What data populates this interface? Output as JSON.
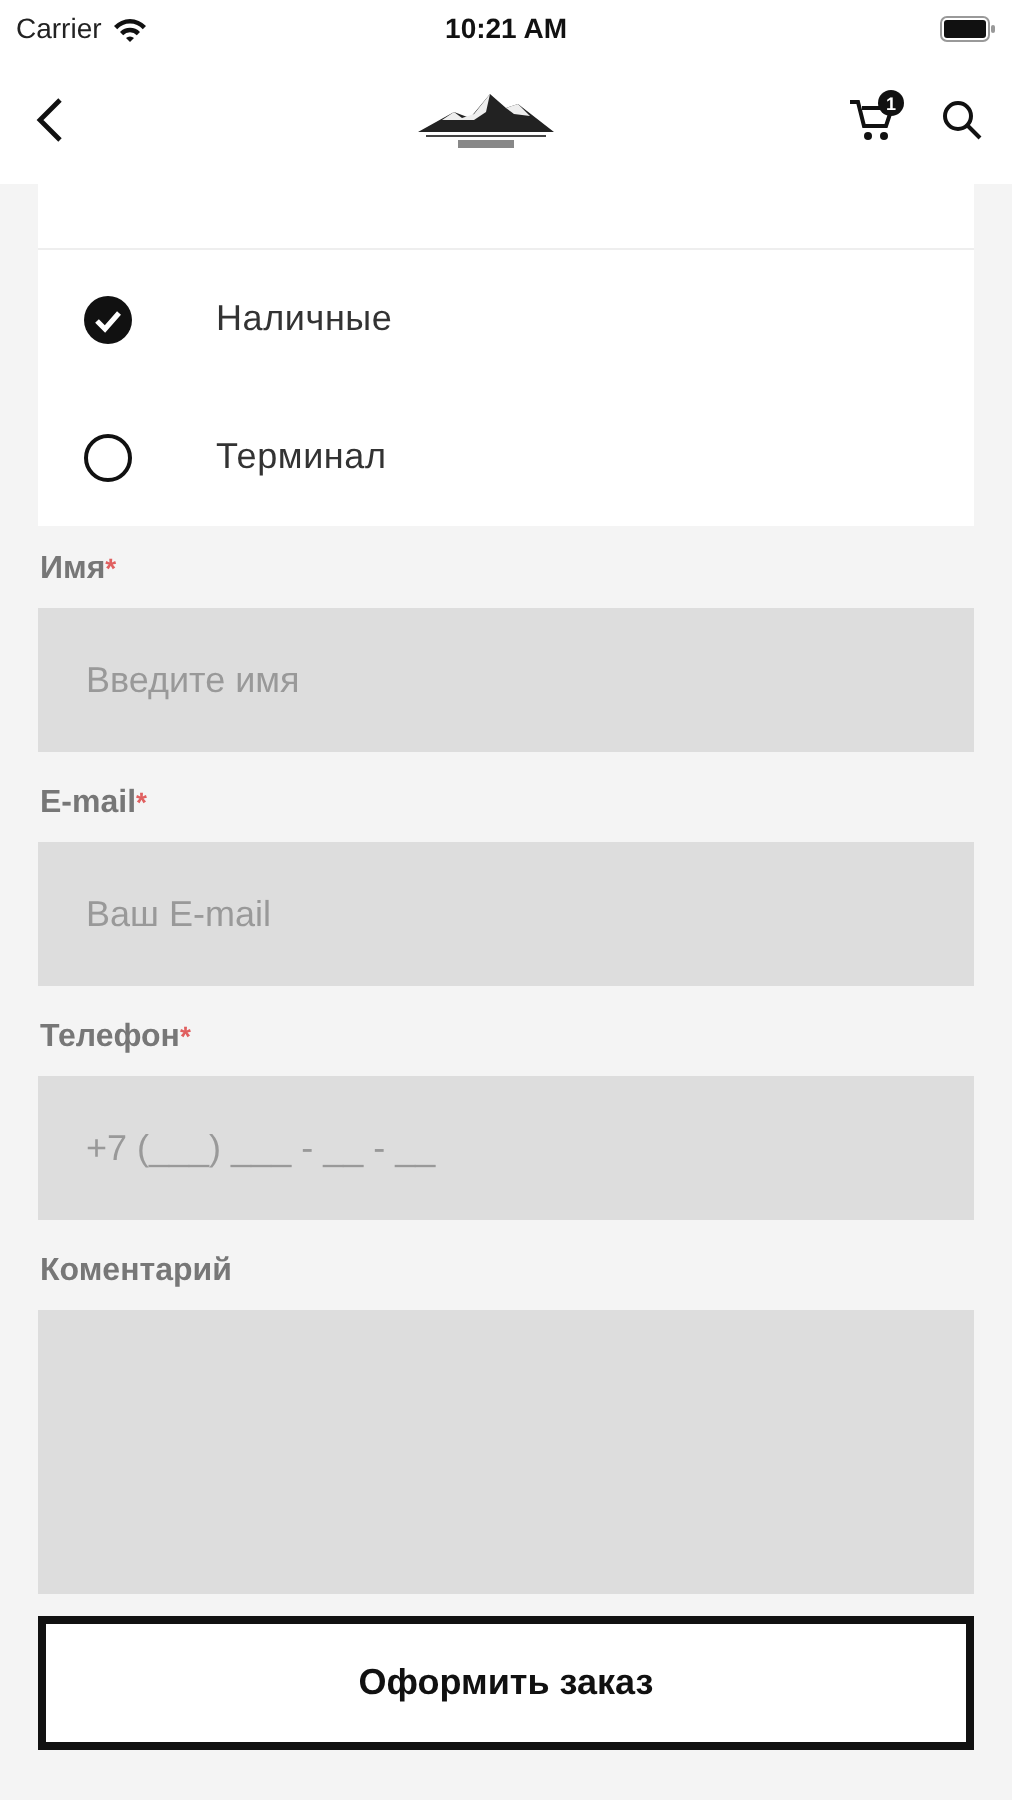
{
  "status_bar": {
    "carrier": "Carrier",
    "time": "10:21 AM"
  },
  "nav": {
    "cart_count": "1"
  },
  "payment": {
    "options": [
      {
        "label": "Наличные",
        "selected": true
      },
      {
        "label": "Терминал",
        "selected": false
      }
    ]
  },
  "fields": [
    {
      "label": "Имя",
      "required_mark": "*",
      "placeholder": "Введите имя",
      "kind": "input"
    },
    {
      "label": "E-mail",
      "required_mark": "*",
      "placeholder": "Ваш E-mail",
      "kind": "input"
    },
    {
      "label": "Телефон",
      "required_mark": "*",
      "placeholder": "+7 (___) ___ - __ - __",
      "kind": "input"
    },
    {
      "label": "Коментарий",
      "kind": "textarea"
    }
  ],
  "submit": "Оформить заказ"
}
